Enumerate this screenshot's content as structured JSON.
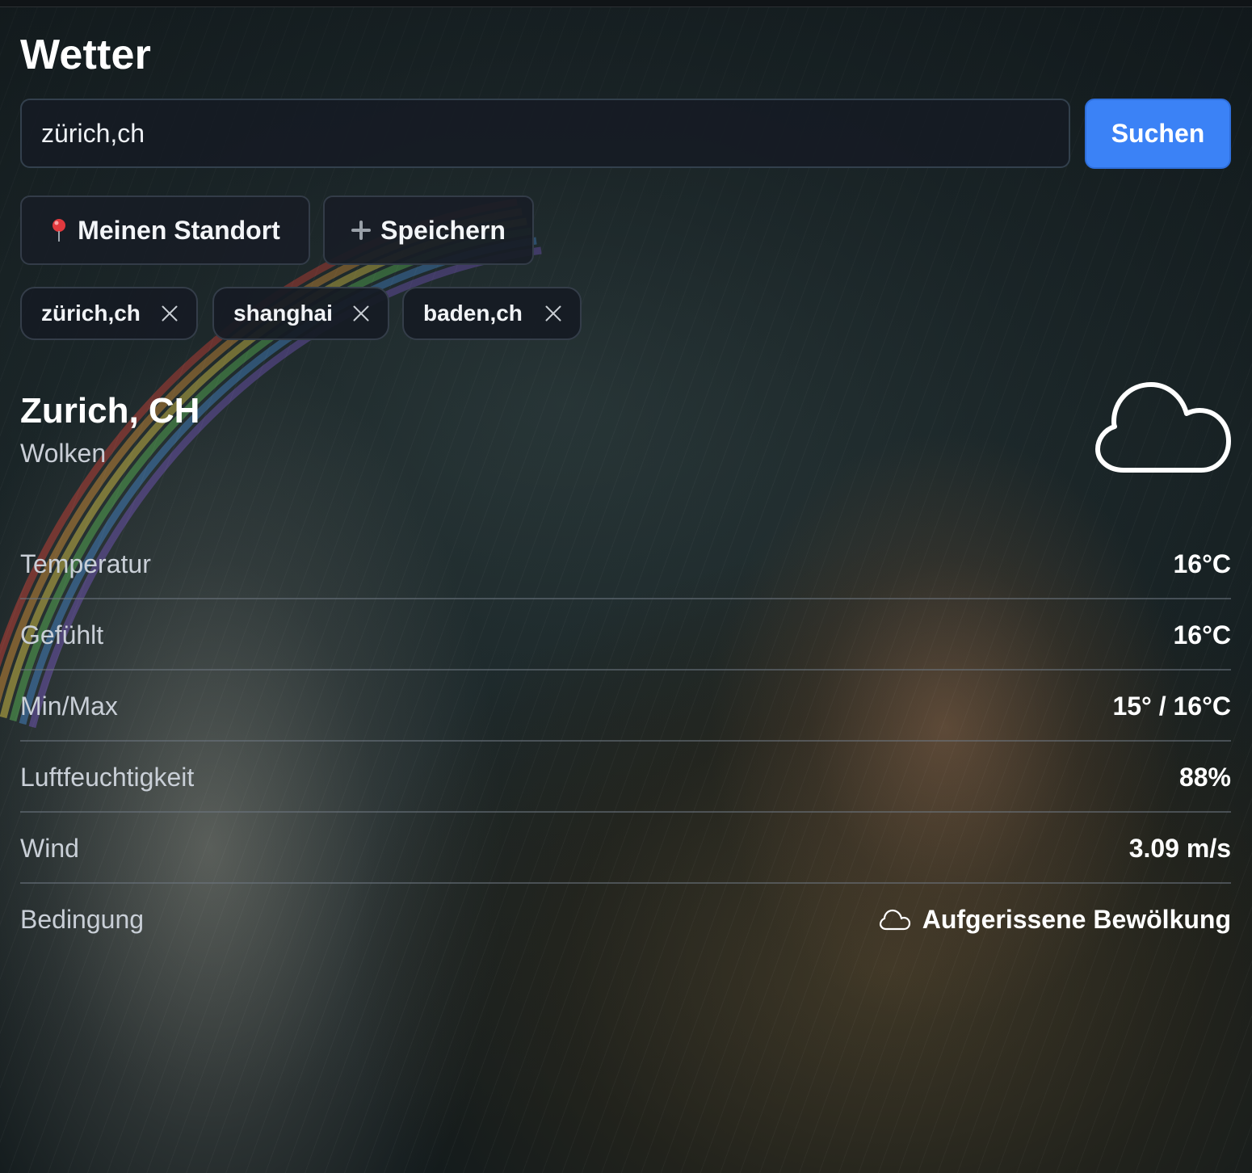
{
  "app": {
    "title": "Wetter"
  },
  "search": {
    "value": "zürich,ch",
    "button_label": "Suchen"
  },
  "actions": {
    "locate_icon": "pin-icon",
    "locate_label": "Meinen Standort",
    "save_icon": "plus-icon",
    "save_label": "Speichern"
  },
  "saved_locations": [
    {
      "label": "zürich,ch",
      "close_icon": "close-icon"
    },
    {
      "label": "shanghai",
      "close_icon": "close-icon"
    },
    {
      "label": "baden,ch",
      "close_icon": "close-icon"
    }
  ],
  "current": {
    "location": "Zurich, CH",
    "summary": "Wolken",
    "icon": "cloud-icon"
  },
  "stats": [
    {
      "label": "Temperatur",
      "value": "16°C"
    },
    {
      "label": "Gefühlt",
      "value": "16°C"
    },
    {
      "label": "Min/Max",
      "value": "15° / 16°C"
    },
    {
      "label": "Luftfeuchtigkeit",
      "value": "88%"
    },
    {
      "label": "Wind",
      "value": "3.09 m/s"
    },
    {
      "label": "Bedingung",
      "value": "Aufgerissene Bewölkung",
      "icon": "cloud-icon"
    }
  ],
  "colors": {
    "accent": "#3b82f6",
    "background": "#1e2a2c",
    "card": "#161b24"
  }
}
